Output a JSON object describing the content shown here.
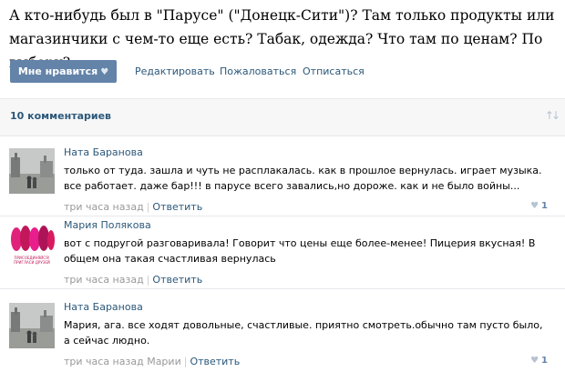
{
  "post": {
    "text": "А кто-нибудь был в \"Парусе\" (\"Донецк-Сити\")? Там только продукты или магазинчики с чем-то еще есть? Табак, одежда? Что там по ценам? По выбору?"
  },
  "actions": {
    "like_label": "Мне нравится",
    "edit_label": "Редактировать",
    "report_label": "Пожаловаться",
    "unsubscribe_label": "Отписаться"
  },
  "comments_header": {
    "count_label": "10 комментариев"
  },
  "comments": [
    {
      "author": "Ната Баранова",
      "text": "только от туда. зашла и чуть не расплакалась. как в прошлое вернулась. играет музыка. все работает. даже бар!!! в парусе всего завались,но дороже. как и не было войны...",
      "time": "три часа назад",
      "mention": "",
      "reply_label": "Ответить",
      "likes": "1"
    },
    {
      "author": "Мария Полякова",
      "text": "вот с подругой разговаривала! Говорит что цены еще более-менее! Пицерия вкусная! В общем она такая счастливая вернулась",
      "time": "три часа назад",
      "mention": "",
      "reply_label": "Ответить",
      "likes": "",
      "avatar_caption": "ПРИСОЕДИНЯЙСЯ! ПРИГЛАСИ ДРУЗЕЙ"
    },
    {
      "author": "Ната Баранова",
      "text": "Мария, ага. все ходят довольные, счастливые. приятно смотреть.обычно там пусто было, а сейчас людно.",
      "time": "три часа назад",
      "mention": "Марии",
      "reply_label": "Ответить",
      "likes": "1"
    }
  ],
  "colors": {
    "link": "#2b587a",
    "button": "#6383a8",
    "meta": "#999999"
  }
}
